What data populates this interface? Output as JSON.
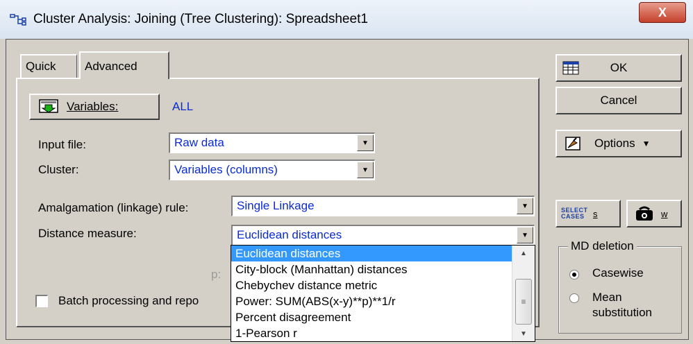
{
  "window": {
    "title": "Cluster Analysis: Joining (Tree Clustering): Spreadsheet1",
    "close_label": "X"
  },
  "tabs": [
    {
      "label": "Quick",
      "active": false
    },
    {
      "label": "Advanced",
      "active": true
    }
  ],
  "variables": {
    "button_label": "Variables:",
    "value": "ALL"
  },
  "fields": {
    "input_file": {
      "label": "Input file:",
      "value": "Raw data"
    },
    "cluster": {
      "label": "Cluster:",
      "value": "Variables (columns)"
    },
    "amalgamation": {
      "label": "Amalgamation (linkage) rule:",
      "value": "Single Linkage"
    },
    "distance": {
      "label": "Distance measure:",
      "value": "Euclidean distances"
    },
    "p_label": "p:"
  },
  "distance_options": [
    "Euclidean distances",
    "City-block (Manhattan) distances",
    "Chebychev distance metric",
    "Power: SUM(ABS(x-y)**p)**1/r",
    "Percent disagreement",
    "1-Pearson r"
  ],
  "batch": {
    "label": "Batch processing and repo",
    "checked": false
  },
  "buttons": {
    "ok": "OK",
    "cancel": "Cancel",
    "options": "Options",
    "select_cases_icon_text": "SELECT CASES",
    "select_cases_shortcut": "S",
    "weight_shortcut": "W"
  },
  "md_deletion": {
    "title": "MD deletion",
    "options": [
      {
        "label": "Casewise",
        "selected": true
      },
      {
        "label": "Mean substitution",
        "selected": false
      }
    ]
  },
  "colors": {
    "dialog_bg": "#d4d0c8",
    "value_text": "#0a2bd6",
    "selection": "#3399ff",
    "close_button": "#c4402a"
  }
}
